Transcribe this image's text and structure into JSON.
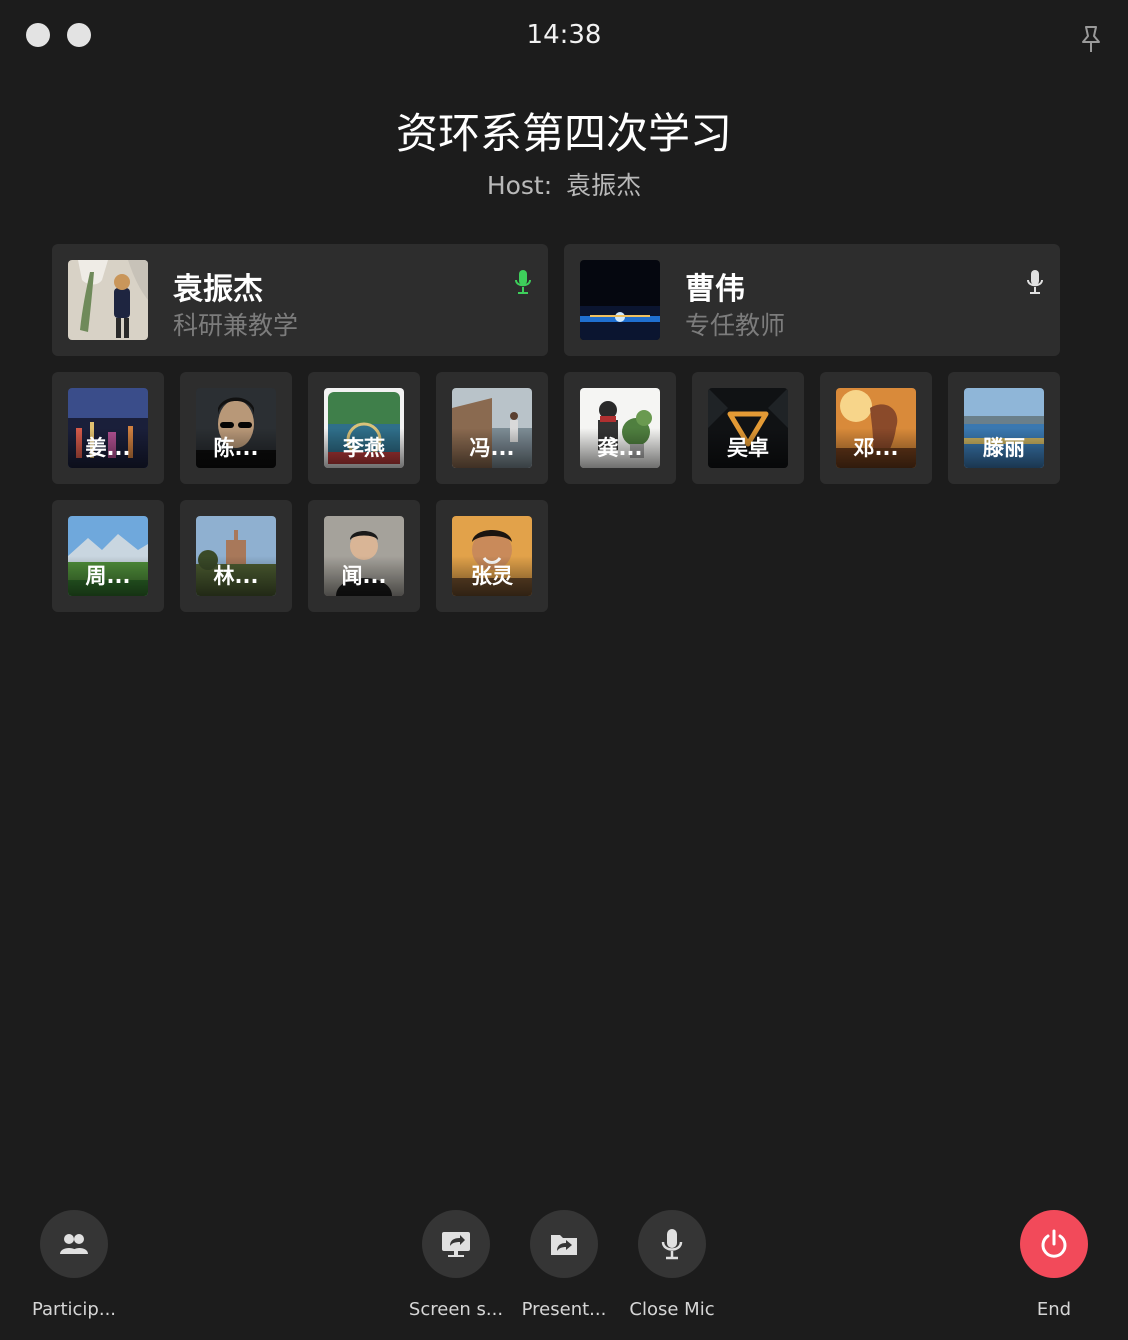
{
  "clock": "14:38",
  "meeting": {
    "title": "资环系第四次学习",
    "host_label": "Host:",
    "host_name": "袁振杰"
  },
  "speakers": [
    {
      "name": "袁振杰",
      "role": "科研兼教学",
      "mic": "mic-on-icon",
      "mic_color": "#3ecf5b"
    },
    {
      "name": "曹伟",
      "role": "专任教师",
      "mic": "mic-icon",
      "mic_color": "#e0e0e0"
    }
  ],
  "participants": [
    {
      "name": "姜..."
    },
    {
      "name": "陈..."
    },
    {
      "name": "李燕"
    },
    {
      "name": "冯..."
    },
    {
      "name": "龚..."
    },
    {
      "name": "吴卓"
    },
    {
      "name": "邓..."
    },
    {
      "name": "滕丽"
    },
    {
      "name": "周..."
    },
    {
      "name": "林..."
    },
    {
      "name": "闻..."
    },
    {
      "name": "张灵"
    }
  ],
  "controls": {
    "participants": {
      "label": "Particip...",
      "icon": "participants-icon"
    },
    "screen_share": {
      "label": "Screen s...",
      "icon": "screen-share-icon"
    },
    "present": {
      "label": "Present...",
      "icon": "present-file-icon"
    },
    "mic": {
      "label": "Close Mic",
      "icon": "microphone-icon"
    },
    "end": {
      "label": "End",
      "icon": "power-icon",
      "color": "#f24a5a"
    }
  }
}
